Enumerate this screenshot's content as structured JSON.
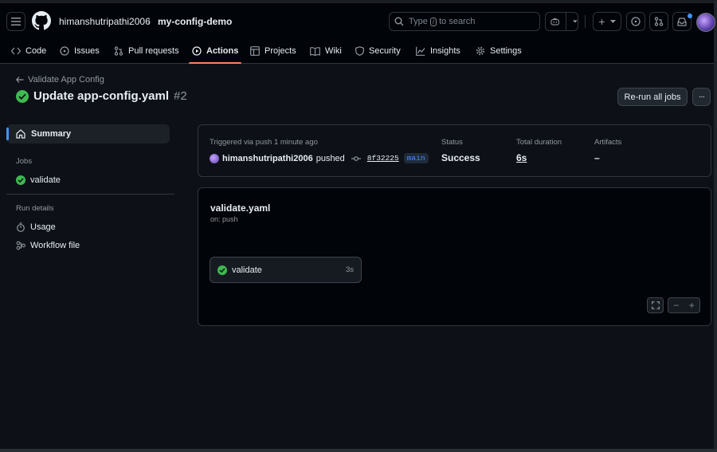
{
  "header": {
    "owner": "himanshutripathi2006",
    "separator": "/",
    "repo": "my-config-demo",
    "search_placeholder_prefix": "Type",
    "search_key": "/",
    "search_placeholder_suffix": "to search",
    "plus_label": "+"
  },
  "tabs": [
    {
      "label": "Code",
      "icon": "code-icon"
    },
    {
      "label": "Issues",
      "icon": "issue-icon"
    },
    {
      "label": "Pull requests",
      "icon": "pull-request-icon"
    },
    {
      "label": "Actions",
      "icon": "play-icon",
      "active": true
    },
    {
      "label": "Projects",
      "icon": "table-icon"
    },
    {
      "label": "Wiki",
      "icon": "book-icon"
    },
    {
      "label": "Security",
      "icon": "shield-icon"
    },
    {
      "label": "Insights",
      "icon": "graph-icon"
    },
    {
      "label": "Settings",
      "icon": "gear-icon"
    }
  ],
  "run": {
    "back_label": "Validate App Config",
    "title": "Update app-config.yaml",
    "number": "#2",
    "rerun_label": "Re-run all jobs",
    "more_label": "···"
  },
  "sidebar": {
    "summary_label": "Summary",
    "jobs_heading": "Jobs",
    "jobs": [
      {
        "label": "validate",
        "status": "success"
      }
    ],
    "run_details_heading": "Run details",
    "details": [
      {
        "label": "Usage",
        "icon": "stopwatch-icon"
      },
      {
        "label": "Workflow file",
        "icon": "file-icon"
      }
    ]
  },
  "summary": {
    "trigger_label": "Triggered via push 1 minute ago",
    "actor": "himanshutripathi2006",
    "action": "pushed",
    "commit": "8f32225",
    "branch": "main",
    "status_label": "Status",
    "status_value": "Success",
    "duration_label": "Total duration",
    "duration_value": "6s",
    "artifacts_label": "Artifacts",
    "artifacts_value": "–"
  },
  "workflow": {
    "file": "validate.yaml",
    "trigger": "on: push",
    "job_name": "validate",
    "job_duration": "3s",
    "zoom_out": "−",
    "zoom_in": "+"
  },
  "colors": {
    "background": "#0d1117",
    "success": "#3fb950",
    "accent": "#4493f8",
    "active_tab_underline": "#f78166"
  }
}
